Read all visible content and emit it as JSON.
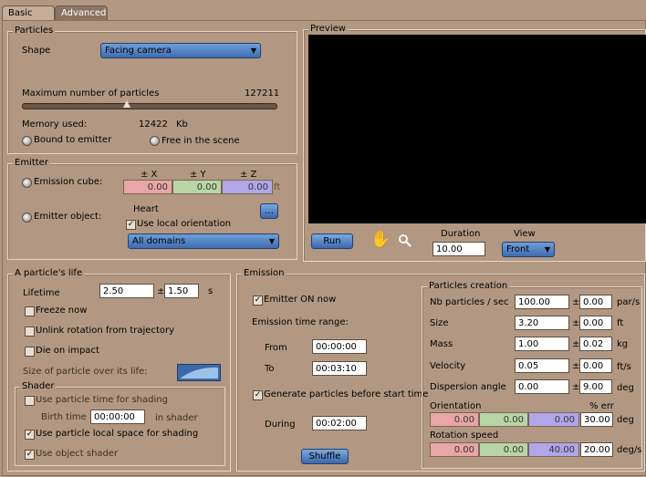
{
  "tabs": [
    "Basic",
    "Advanced"
  ],
  "particles": {
    "legend": "Particles",
    "shape_label": "Shape",
    "shape_value": "Facing camera",
    "max_label": "Maximum number of particles",
    "max_value": "127211",
    "memory_label": "Memory used:",
    "memory_value": "12422",
    "memory_unit": "Kb",
    "bound_label": "Bound to emitter",
    "free_label": "Free in the scene"
  },
  "emitter": {
    "legend": "Emitter",
    "cube_label": "Emission cube:",
    "hx": "± X",
    "hy": "± Y",
    "hz": "± Z",
    "cx": "0.00",
    "cy": "0.00",
    "cz": "0.00",
    "unit": "ft",
    "object_label": "Emitter object:",
    "object_name": "Heart",
    "browse": "...",
    "local_orient": "Use local orientation",
    "domains": "All domains"
  },
  "preview": {
    "legend": "Preview",
    "run": "Run",
    "duration_label": "Duration",
    "duration_value": "10.00",
    "view_label": "View",
    "view_value": "Front"
  },
  "life": {
    "legend": "A particle's life",
    "lifetime_label": "Lifetime",
    "lifetime": "2.50",
    "pm": "±",
    "lifetime_err": "1.50",
    "unit": "s",
    "freeze": "Freeze now",
    "unlink": "Unlink rotation from trajectory",
    "die": "Die on impact",
    "size_over": "Size of particle over its life:",
    "shader_legend": "Shader",
    "use_time": "Use particle time for shading",
    "birth_label": "Birth time is",
    "birth_value": "00:00:00",
    "in_shader": "in shader",
    "local_space": "Use particle local space for shading",
    "object_shader": "Use object shader"
  },
  "emission": {
    "legend": "Emission",
    "on_now": "Emitter ON now",
    "range": "Emission time range:",
    "from_label": "From",
    "from_value": "00:00:00",
    "to_label": "To",
    "to_value": "00:03:10",
    "gen_before": "Generate particles before start time",
    "during_label": "During",
    "during_value": "00:02:00",
    "shuffle": "Shuffle"
  },
  "creation": {
    "legend": "Particles creation",
    "rows": [
      {
        "label": "Nb particles / sec",
        "value": "100.00",
        "err": "0.00",
        "unit": "par/s"
      },
      {
        "label": "Size",
        "value": "3.20",
        "err": "0.00",
        "unit": "ft"
      },
      {
        "label": "Mass",
        "value": "1.00",
        "err": "0.02",
        "unit": "kg"
      },
      {
        "label": "Velocity",
        "value": "0.05",
        "err": "0.00",
        "unit": "ft/s"
      },
      {
        "label": "Dispersion angle",
        "value": "0.00",
        "err": "9.00",
        "unit": "deg"
      }
    ],
    "pm": "±",
    "orientation_label": "Orientation",
    "err_label": "% err",
    "orientation": [
      "0.00",
      "0.00",
      "0.00",
      "30.00"
    ],
    "orientation_unit": "deg",
    "rotation_label": "Rotation speed",
    "rotation": [
      "0.00",
      "0.00",
      "40.00",
      "20.00"
    ],
    "rotation_unit": "deg/s"
  },
  "colors": {
    "field_x": "#e8a6a6",
    "field_y": "#b8d6a6",
    "field_z": "#b0a6e8",
    "dropdown": "#4f7fc4"
  }
}
